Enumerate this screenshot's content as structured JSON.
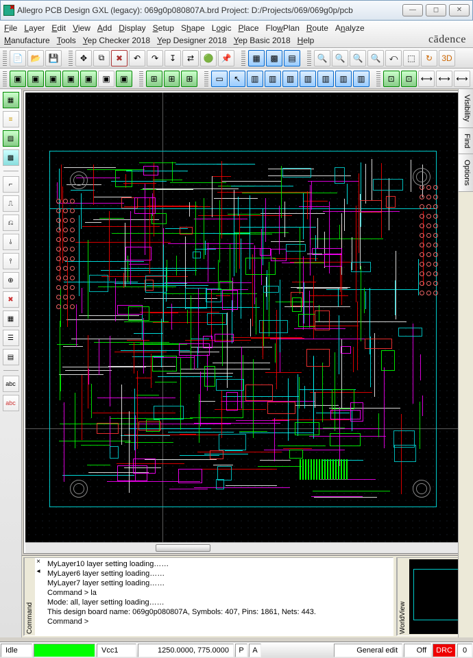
{
  "title": "Allegro PCB Design GXL (legacy): 069g0p080807A.brd  Project: D:/Projects/069/069g0p/pcb",
  "menus": {
    "row1": [
      "File",
      "Layer",
      "Edit",
      "View",
      "Add",
      "Display",
      "Setup",
      "Shape",
      "Logic",
      "Place",
      "FlowPlan",
      "Route",
      "Analyze"
    ],
    "row2": [
      "Manufacture",
      "Tools",
      "Yep Checker 2018",
      "Yep Designer 2018",
      "Yep Basic 2018",
      "Help"
    ]
  },
  "brand": "cādence",
  "right_tabs": [
    "Visibility",
    "Find",
    "Options"
  ],
  "command": {
    "tab_label": "Command",
    "lines": [
      "MyLayer10 layer setting loading……",
      "MyLayer6 layer setting loading……",
      "MyLayer7 layer setting loading……",
      "Command > la",
      "Mode: all, layer setting loading……",
      "This design board name: 069g0p080807A, Symbols: 407, Pins: 1861, Nets: 443.",
      "Command >"
    ]
  },
  "worldview": {
    "tab_label": "WorldView"
  },
  "status": {
    "idle": "Idle",
    "layer": "Vcc1",
    "coords": "1250.0000, 775.0000",
    "p": "P",
    "a": "A",
    "mode": "General edit",
    "off": "Off",
    "drc": "DRC",
    "count": "0"
  }
}
